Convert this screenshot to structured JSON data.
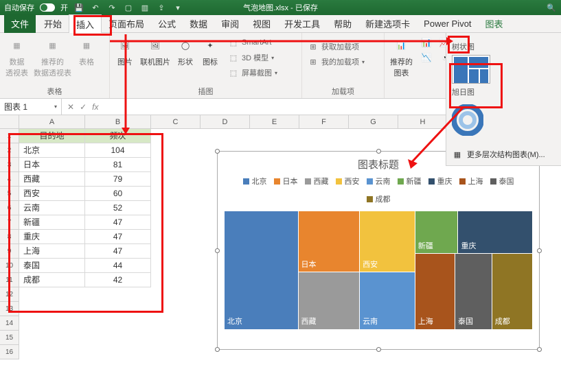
{
  "titlebar": {
    "autosave": "自动保存",
    "autosave_on": "开",
    "filename": "气泡地图.xlsx",
    "saved": "已保存"
  },
  "menu": {
    "file": "文件",
    "home": "开始",
    "insert": "插入",
    "pagelayout": "页面布局",
    "formulas": "公式",
    "data": "数据",
    "review": "审阅",
    "view": "视图",
    "developer": "开发工具",
    "help": "帮助",
    "newtab": "新建选项卡",
    "powerpivot": "Power Pivot",
    "chart_format": "图表"
  },
  "ribbon": {
    "grp_tables": "表格",
    "pivot": "数据\n透视表",
    "recpivot": "推荐的\n数据透视表",
    "table": "表格",
    "grp_illust": "插图",
    "pic": "图片",
    "onlinepic": "联机图片",
    "shapes": "形状",
    "icons": "图标",
    "smartart": "SmartArt",
    "model3d": "3D 模型",
    "screenshot": "屏幕截图",
    "grp_addins": "加载项",
    "getaddin": "获取加载项",
    "myaddin": "我的加载项",
    "grp_charts": "推荐的\n图表",
    "treemap_section": "树状图",
    "sunburst_section": "旭日图",
    "more_hierarchy": "更多层次结构图表(M)..."
  },
  "namebox": {
    "name": "图表 1"
  },
  "cols": [
    "A",
    "B",
    "C",
    "D",
    "E",
    "F",
    "G",
    "H"
  ],
  "rows": [
    "1",
    "2",
    "3",
    "4",
    "5",
    "6",
    "7",
    "8",
    "9",
    "10",
    "11",
    "12",
    "13",
    "14",
    "15",
    "16"
  ],
  "table": {
    "hdr_city": "目的地",
    "hdr_freq": "频次",
    "rows": [
      {
        "city": "北京",
        "freq": "104"
      },
      {
        "city": "日本",
        "freq": "81"
      },
      {
        "city": "西藏",
        "freq": "79"
      },
      {
        "city": "西安",
        "freq": "60"
      },
      {
        "city": "云南",
        "freq": "52"
      },
      {
        "city": "新疆",
        "freq": "47"
      },
      {
        "city": "重庆",
        "freq": "47"
      },
      {
        "city": "上海",
        "freq": "47"
      },
      {
        "city": "泰国",
        "freq": "44"
      },
      {
        "city": "成都",
        "freq": "42"
      }
    ]
  },
  "chart": {
    "title": "图表标题"
  },
  "chart_data": {
    "type": "treemap",
    "title": "图表标题",
    "series": [
      {
        "name": "北京",
        "value": 104,
        "color": "#4a7ebb"
      },
      {
        "name": "日本",
        "value": 81,
        "color": "#e8852e"
      },
      {
        "name": "西藏",
        "value": 79,
        "color": "#9a9a9a"
      },
      {
        "name": "西安",
        "value": 60,
        "color": "#f2c23e"
      },
      {
        "name": "云南",
        "value": 52,
        "color": "#5a93d0"
      },
      {
        "name": "新疆",
        "value": 47,
        "color": "#6fa84f"
      },
      {
        "name": "重庆",
        "value": 47,
        "color": "#33506d"
      },
      {
        "name": "上海",
        "value": 47,
        "color": "#a8541c"
      },
      {
        "name": "泰国",
        "value": 44,
        "color": "#5f5f5f"
      },
      {
        "name": "成都",
        "value": 42,
        "color": "#8f7524"
      }
    ]
  }
}
